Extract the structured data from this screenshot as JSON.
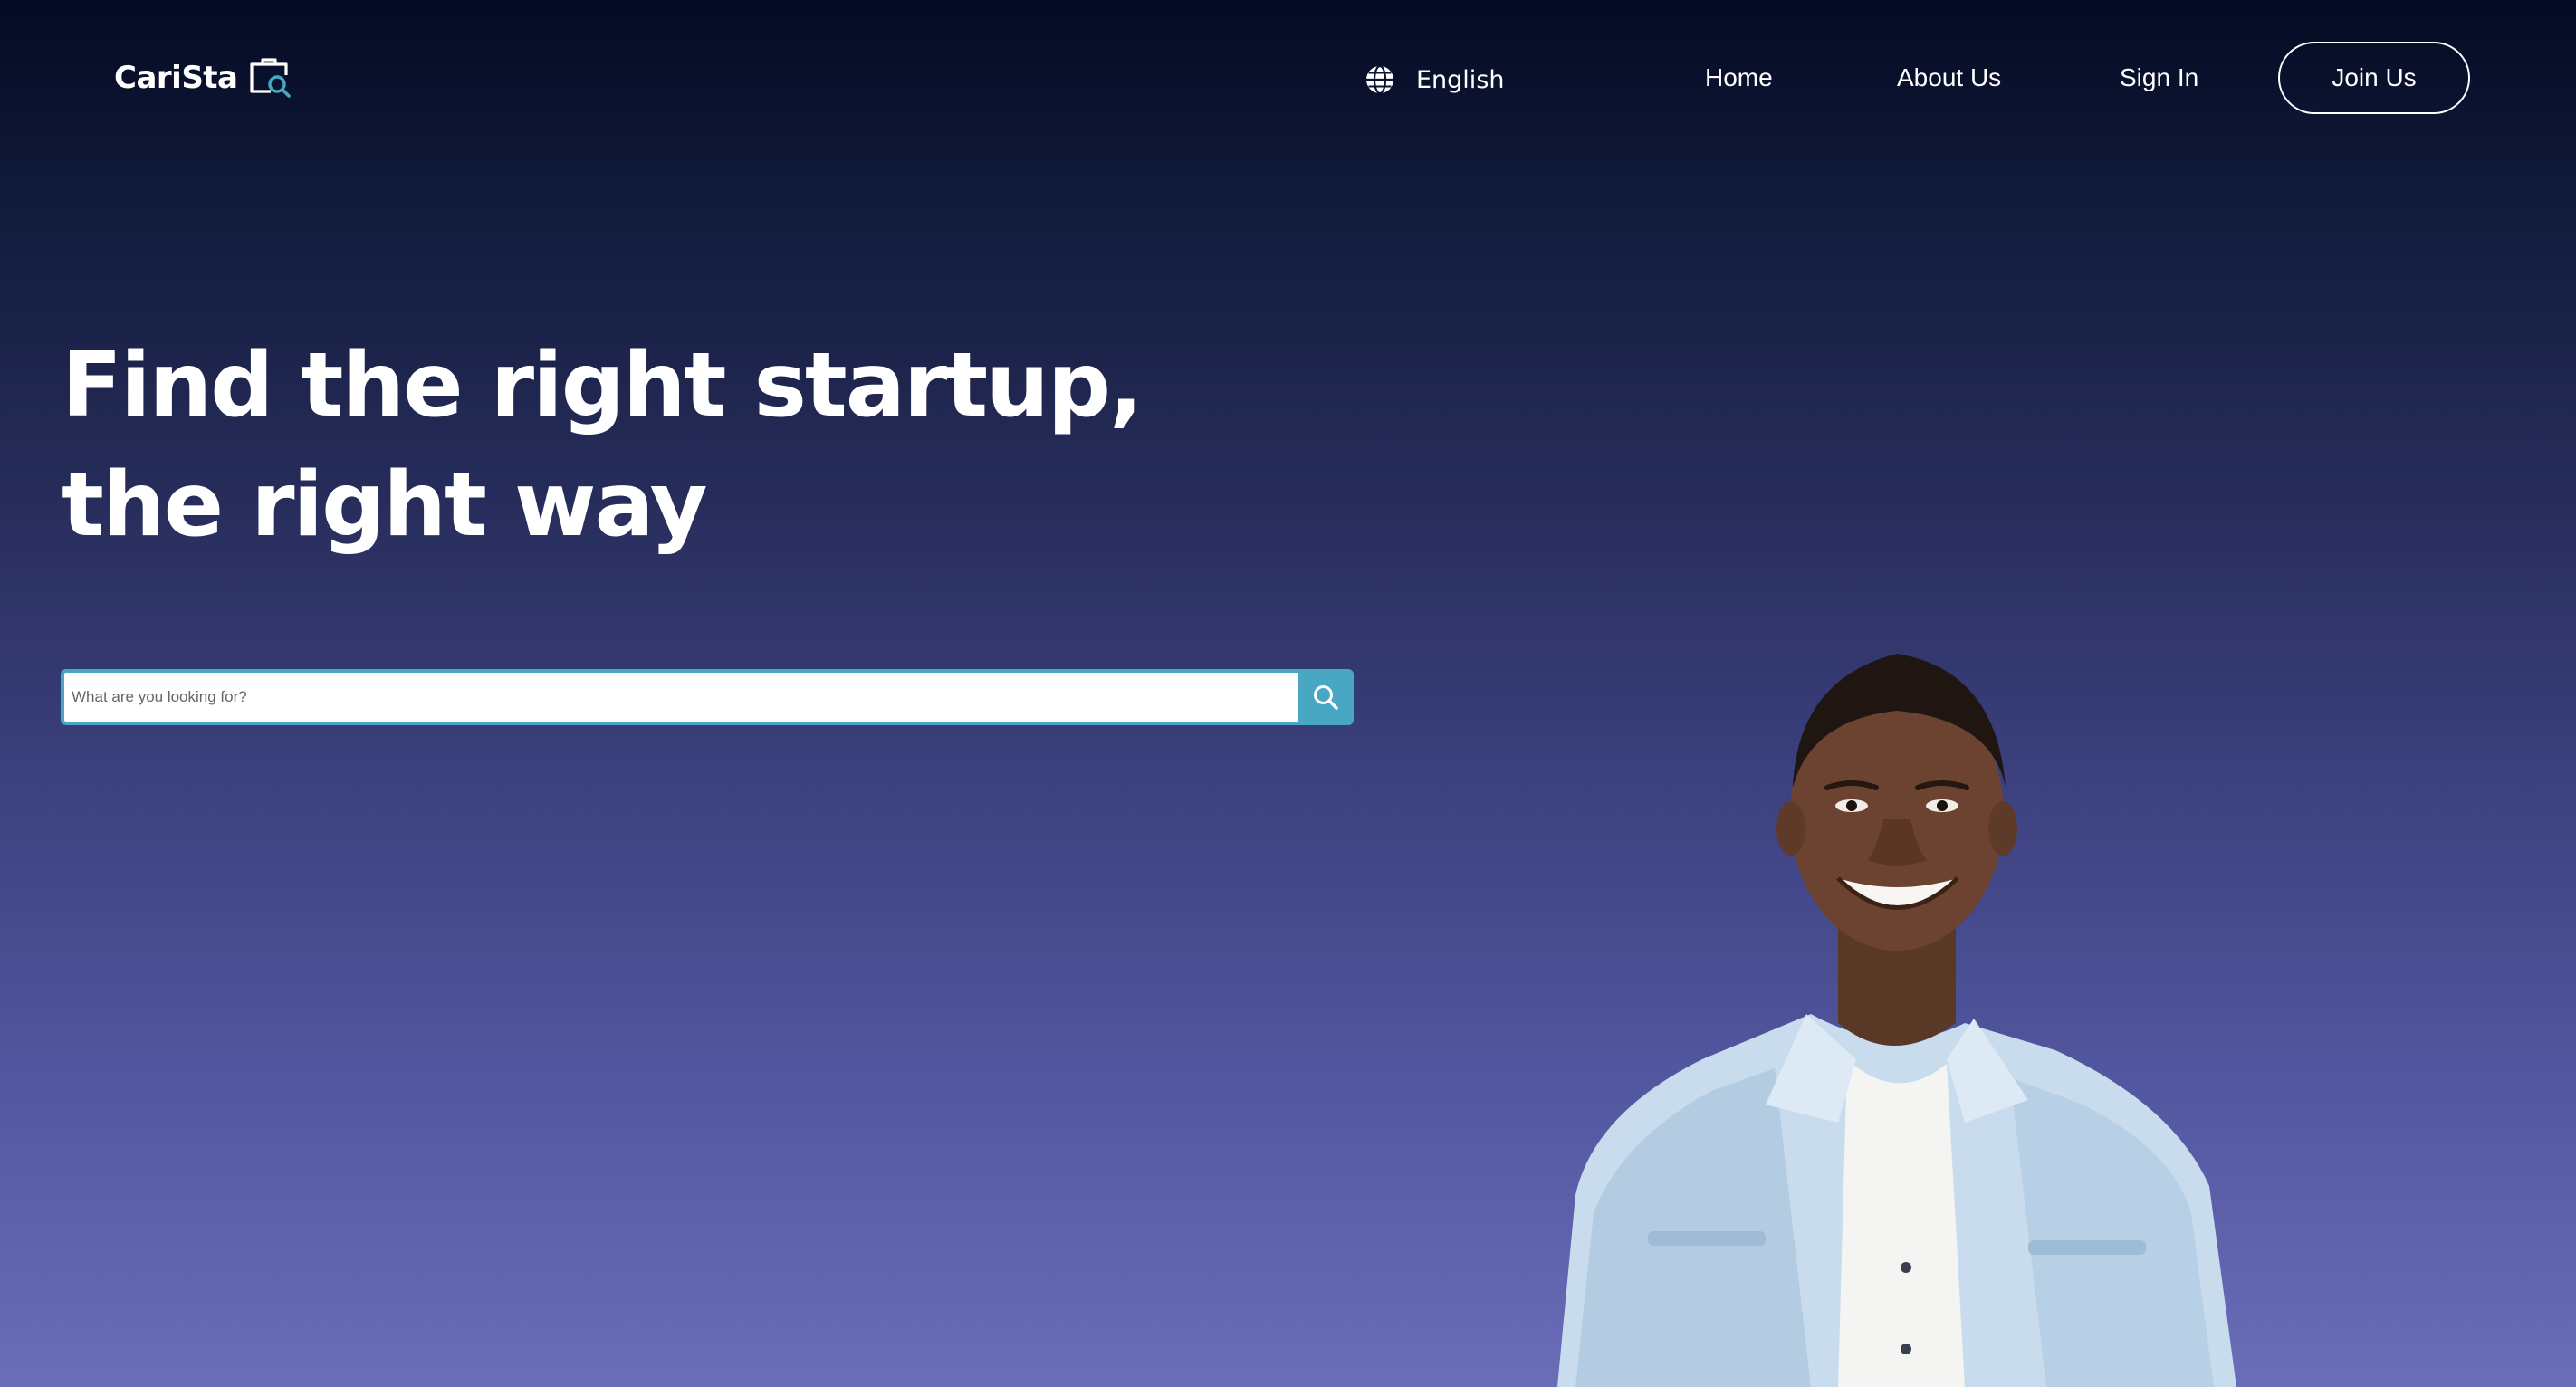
{
  "brand": {
    "name": "CariSta",
    "logo_icon": "briefcase-search-icon"
  },
  "nav": {
    "language": {
      "label": "English",
      "icon": "globe-icon"
    },
    "links": {
      "home": "Home",
      "about": "About Us",
      "signin": "Sign In"
    },
    "join_label": "Join Us"
  },
  "hero": {
    "headline_line1": "Find the right startup,",
    "headline_line2": "the right way",
    "search": {
      "placeholder": "What are you looking for?",
      "button_icon": "search-icon"
    }
  },
  "colors": {
    "accent": "#48a8c4",
    "background_top": "#040a22",
    "background_bottom": "#6a6db8",
    "text": "#ffffff"
  }
}
